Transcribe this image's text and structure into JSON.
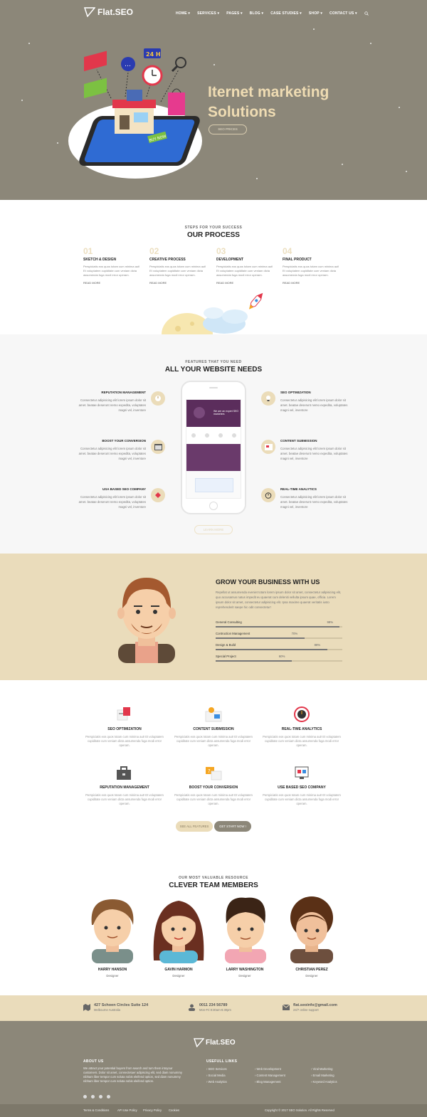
{
  "brand": {
    "name": "Flat.SEO"
  },
  "nav": [
    "HOME ▾",
    "SERVICES ▾",
    "PAGES ▾",
    "BLOG ▾",
    "CASE STUDIES ▾",
    "SHOP ▾",
    "CONTACT US ▾"
  ],
  "hero": {
    "title_line1": "Iternet marketing",
    "title_line2": "Solutions",
    "button": "SEO PRICES",
    "sign_24h": "24 H",
    "sign_buy": "BUY NOW"
  },
  "process": {
    "subtitle": "STEPS FOR YOUR SUCCESS",
    "title": "OUR PROCESS",
    "steps": [
      {
        "num": "01",
        "title": "SKETCH & DESIGN",
        "desc": "Perspiciatis eos quos totam cum minima aut! Et voluptatem cupiditate cum veniam dicta assumenda fuga modi error operam.",
        "more": "READ MORE"
      },
      {
        "num": "02",
        "title": "CREATIVE PROCESS",
        "desc": "Perspiciatis eos quos totam cum minima aut! Et voluptatem cupiditate cum veniam dicta assumenda fuga modi error operam.",
        "more": "READ MORE"
      },
      {
        "num": "03",
        "title": "DEVELOPMENT",
        "desc": "Perspiciatis eos quos totam cum minima aut! Et voluptatem cupiditate cum veniam dicta assumenda fuga modi error operam.",
        "more": "READ MORE"
      },
      {
        "num": "04",
        "title": "FINAL PRODUCT",
        "desc": "Perspiciatis eos quos totam cum minima aut! Et voluptatem cupiditate cum veniam dicta assumenda fuga modi error operam.",
        "more": "READ MORE"
      }
    ]
  },
  "features": {
    "subtitle": "FEATURES THAT YOU NEED",
    "title": "ALL YOUR WEBSITE NEEDS",
    "left": [
      {
        "title": "REPUTATION MANAGEMENT",
        "desc": "Consectetur adipisicing elit lorem ipsum dolor sit amet. beatae deserunt nemo expedita, voluptates magni vel, inventore"
      },
      {
        "title": "BOOST YOUR CONVERSION",
        "desc": "Consectetur adipisicing elit lorem ipsum dolor sit amet. beatae deserunt nemo expedita, voluptates magni vel, inventore"
      },
      {
        "title": "USA BASED SEO COMPANY",
        "desc": "Consectetur adipisicing elit lorem ipsum dolor sit amet. beatae deserunt nemo expedita, voluptates magni vel, inventore"
      }
    ],
    "right": [
      {
        "title": "SEO OPTIMIZATION",
        "desc": "Consectetur adipisicing elit lorem ipsum dolor sit amet. beatae deserunt nemo expedita, voluptates magni vel, inventore"
      },
      {
        "title": "CONTENT SUBMISSION",
        "desc": "Consectetur adipisicing elit lorem ipsum dolor sit amet. beatae deserunt nemo expedita, voluptates magni vel, inventore"
      },
      {
        "title": "REAL-TIME ANALYTICS",
        "desc": "Consectetur adipisicing elit lorem ipsum dolor sit amet. beatae deserunt nemo expedita, voluptates magni vel, inventore"
      }
    ],
    "phone_banner": "We are an expert SEO marketers",
    "button": "LEARN MORE"
  },
  "grow": {
    "title": "GROW YOUR BUSINESS WITH US",
    "desc": "Repellat ut assumenda eveniet totam lorem ipsum dolor sit amet, consectetur adipisicing elit, quo accusamus natus impedit eu quaerat cum deleniti vellulta ipsum quae, officia. Lorem ipsum dolor sit amet, consectetur adipisicing elit. Ipsa maxime quaerat veritatis iusto reprehenderit saepe hic odit consectetur!",
    "bars": [
      {
        "label": "General Consulting",
        "pct": "98%",
        "value": 98
      },
      {
        "label": "Contruction Management",
        "pct": "70%",
        "value": 70
      },
      {
        "label": "Design & Build",
        "pct": "88%",
        "value": 88
      },
      {
        "label": "Special Project",
        "pct": "60%",
        "value": 60
      }
    ]
  },
  "services": {
    "items": [
      {
        "title": "SEO OPTIMIZATION",
        "desc": "Perspiciatis eos quos totam cum minima aut! Et voluptatem cupiditate cum veniam dicta assumenda fuga modi error operam."
      },
      {
        "title": "CONTENT SUBMISSION",
        "desc": "Perspiciatis eos quos totam cum minima aut! Et voluptatem cupiditate cum veniam dicta assumenda fuga modi error operam."
      },
      {
        "title": "REAL-TIME ANALYTICS",
        "desc": "Perspiciatis eos quos totam cum minima aut! Et voluptatem cupiditate cum veniam dicta assumenda fuga modi error operam."
      },
      {
        "title": "REPUTATION MANAGEMENT",
        "desc": "Perspiciatis eos quos totam cum minima aut! Et voluptatem cupiditate cum veniam dicta assumenda fuga modi error operam."
      },
      {
        "title": "BOOST YOUR CONVERSION",
        "desc": "Perspiciatis eos quos totam cum minima aut! Et voluptatem cupiditate cum veniam dicta assumenda fuga modi error operam."
      },
      {
        "title": "USE BASED SEO COMPANY",
        "desc": "Perspiciatis eos quos totam cum minima aut! Et voluptatem cupiditate cum veniam dicta assumenda fuga modi error operam."
      }
    ],
    "btn_all": "SEE ALL FEATURES",
    "btn_start": "GET START NOW !"
  },
  "team": {
    "subtitle": "OUR MOST VALUABLE RESOURCE",
    "title": "CLEVER TEAM MEMBERS",
    "members": [
      {
        "name": "HARRY HANSON",
        "role": "Designer"
      },
      {
        "name": "GAVIN HARMON",
        "role": "Designer"
      },
      {
        "name": "LARRY WASHINGTON",
        "role": "Designer"
      },
      {
        "name": "CHRISTIAN PEREZ",
        "role": "Designer"
      }
    ]
  },
  "contact": {
    "address": "427 Schoen Circles Suite 124",
    "address_sub": "Melbourne Australia",
    "phone": "0011 234 56789",
    "phone_sub": "Mon-Fri 8:30am-6:30pm",
    "email": "flat.seoinfo@gmail.com",
    "email_sub": "24/7 online support"
  },
  "footer": {
    "about_title": "ABOUT US",
    "about_text": "We attract your potential buyers from search and turn them intoyour customers. Dolor sit amet, consectetuer adipiscing elit, sed diam nonummy nibham liber tempor cum soluta nobis eleifend option, sed diam nonummy nibham liber tempor cum soluta nobis eleifend option.",
    "links_title": "USEFULL LINKS",
    "links": [
      "› SEO Services",
      "› Social Media",
      "› Web Analytics",
      "› Web Development",
      "› Content Management",
      "› Blog Management",
      "› Viral Marketing",
      "› Email Marketing",
      "› Keyword Analytics"
    ],
    "bottom_links": [
      "Terms & Conditions",
      "API Use Policy",
      "Privacy Policy",
      "Cookies"
    ],
    "copyright": "Copyright © 2017 SEO Solution. All Rights Reserved"
  },
  "colors": {
    "hero_bg": "#8c8779",
    "beige": "#eadcbb",
    "accent_text": "#efdcb3"
  }
}
